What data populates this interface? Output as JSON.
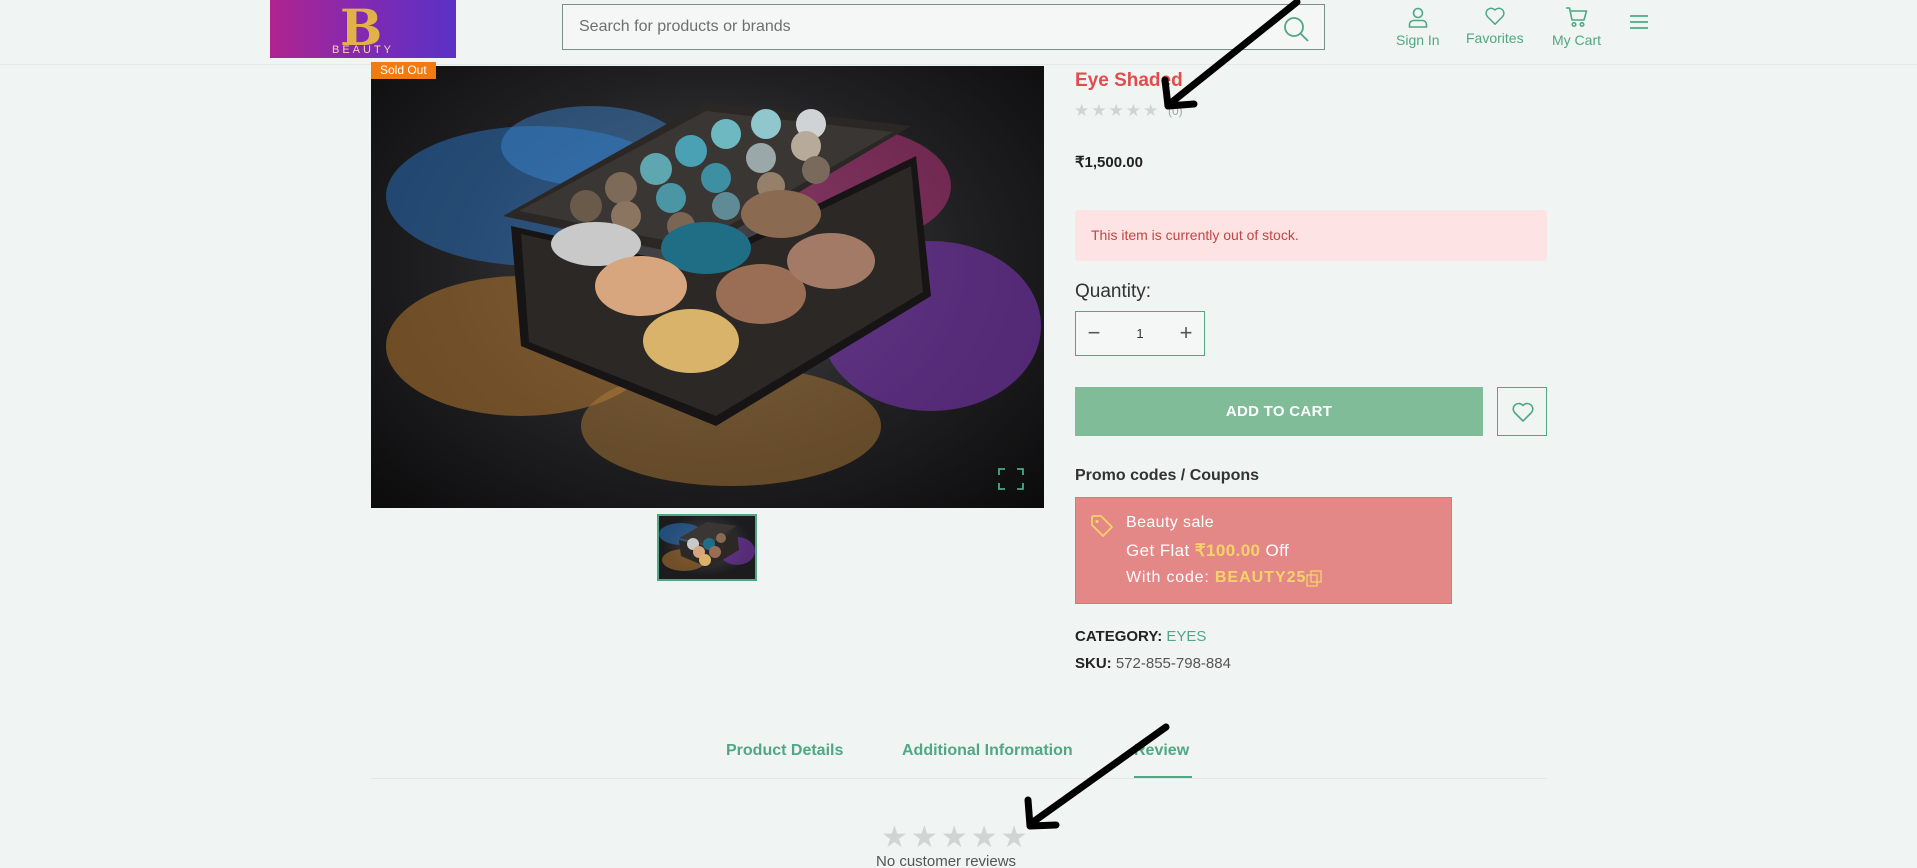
{
  "header": {
    "logo": {
      "monogram": "B",
      "wordmark": "BEAUTY"
    },
    "search": {
      "placeholder": "Search for products or brands",
      "icon": "search-icon"
    },
    "sign_in": "Sign In",
    "favorites": "Favorites",
    "cart": "My Cart",
    "menu_icon": "hamburger-icon",
    "accent_color": "#4fa883"
  },
  "gallery": {
    "badge": "Sold Out",
    "badge_color": "#f07b12",
    "image": "eyeshadow-palette",
    "expand_icon": "fullscreen-icon"
  },
  "product": {
    "title": "Eye Shaded",
    "title_color": "#e04d4d",
    "rating": {
      "value": 0,
      "max": 5,
      "count": "(0)"
    },
    "price": "₹1,500.00",
    "stock_message": "This item is currently out of stock.",
    "quantity_label": "Quantity:",
    "quantity_value": "1",
    "add_to_cart": "ADD TO CART",
    "wishlist_icon": "heart-icon",
    "promo_heading": "Promo codes / Coupons",
    "promo": {
      "title": "Beauty sale",
      "line_prefix": "Get Flat",
      "amount": "₹100.00",
      "line_suffix": "Off",
      "code_label": "With code:",
      "code": "BEAUTY25",
      "copy_icon": "copy-icon",
      "tag_icon": "tag-icon",
      "background": "#e48787"
    },
    "category_label": "CATEGORY:",
    "category": "EYES",
    "sku_label": "SKU:",
    "sku": "572-855-798-884"
  },
  "tabs": [
    {
      "label": "Product Details"
    },
    {
      "label": "Additional Information"
    },
    {
      "label": "Review",
      "active": true
    }
  ],
  "reviews": {
    "rating_max": 5,
    "empty_text": "No customer reviews"
  },
  "annotations": {
    "arrows": 2,
    "color": "#000000"
  }
}
